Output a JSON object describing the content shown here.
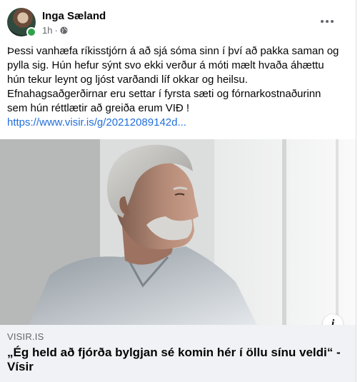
{
  "post": {
    "author": "Inga Sæland",
    "time": "1h",
    "separator": "·",
    "body": "Þessi vanhæfa ríkisstjórn á að sjá sóma sinn í því að pakka saman og pylla sig. Hún hefur sýnt svo ekki verður á móti mælt hvaða áhættu hún tekur leynt og ljóst varðandi líf okkar og heilsu. Efnahagsaðgerðirnar eru settar í fyrsta sæti og fórnarkostnaðurinn sem hún réttlætir að greiða erum VIÐ !",
    "link_text": "https://www.visir.is/g/20212089142d..."
  },
  "link_preview": {
    "domain": "VISIR.IS",
    "title": "„Ég held að fjórða bylgjan sé komin hér í öllu sínu veldi“ - Vísir",
    "info_label": "i"
  },
  "icons": {
    "privacy": "globe-icon",
    "more": "more-options-icon",
    "info": "info-icon",
    "online": "online-status-icon"
  },
  "colors": {
    "link": "#216fdb",
    "online": "#31a24c",
    "card_bg": "#f0f2f5",
    "secondary_text": "#65676b"
  }
}
